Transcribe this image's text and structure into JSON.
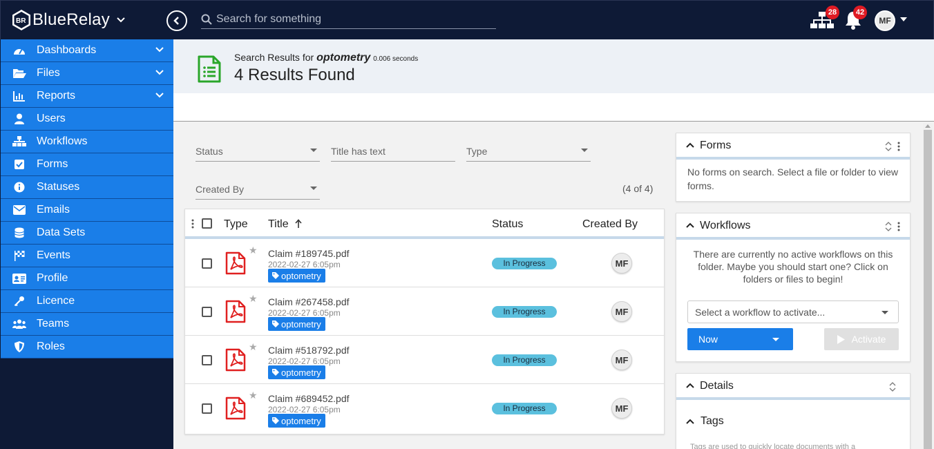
{
  "app": {
    "name": "BlueRelay",
    "logo_letters": "BR"
  },
  "search": {
    "placeholder": "Search for something"
  },
  "notifications": {
    "workflow_count": "28",
    "bell_count": "42"
  },
  "user": {
    "initials": "MF"
  },
  "sidebar": {
    "items": [
      {
        "label": "Dashboards",
        "icon": "dashboard-icon",
        "expandable": true
      },
      {
        "label": "Files",
        "icon": "folder-open-icon",
        "expandable": true
      },
      {
        "label": "Reports",
        "icon": "chart-icon",
        "expandable": true
      },
      {
        "label": "Users",
        "icon": "user-icon",
        "expandable": false
      },
      {
        "label": "Workflows",
        "icon": "sitemap-icon",
        "expandable": false
      },
      {
        "label": "Forms",
        "icon": "check-square-icon",
        "expandable": false
      },
      {
        "label": "Statuses",
        "icon": "info-circle-icon",
        "expandable": false
      },
      {
        "label": "Emails",
        "icon": "envelope-icon",
        "expandable": false
      },
      {
        "label": "Data Sets",
        "icon": "database-icon",
        "expandable": false
      },
      {
        "label": "Events",
        "icon": "flag-checkered-icon",
        "expandable": false
      },
      {
        "label": "Profile",
        "icon": "id-card-icon",
        "expandable": false
      },
      {
        "label": "Licence",
        "icon": "key-icon",
        "expandable": false
      },
      {
        "label": "Teams",
        "icon": "users-icon",
        "expandable": false
      },
      {
        "label": "Roles",
        "icon": "shield-icon",
        "expandable": false
      }
    ]
  },
  "results": {
    "prefix": "Search Results for",
    "query": "optometry",
    "seconds": "0.006 seconds",
    "count_text": "4 Results Found",
    "paging": "(4 of 4)"
  },
  "filters": {
    "status_placeholder": "Status",
    "title_placeholder": "Title has text",
    "type_placeholder": "Type",
    "created_by_placeholder": "Created By"
  },
  "table": {
    "columns": {
      "type": "Type",
      "title": "Title",
      "status": "Status",
      "created_by": "Created By"
    },
    "rows": [
      {
        "title": "Claim #189745.pdf",
        "date": "2022-02-27 6:05pm",
        "tag": "optometry",
        "status": "In Progress",
        "creator": "MF"
      },
      {
        "title": "Claim #267458.pdf",
        "date": "2022-02-27 6:05pm",
        "tag": "optometry",
        "status": "In Progress",
        "creator": "MF"
      },
      {
        "title": "Claim #518792.pdf",
        "date": "2022-02-27 6:05pm",
        "tag": "optometry",
        "status": "In Progress",
        "creator": "MF"
      },
      {
        "title": "Claim #689452.pdf",
        "date": "2022-02-27 6:05pm",
        "tag": "optometry",
        "status": "In Progress",
        "creator": "MF"
      }
    ]
  },
  "panels": {
    "forms": {
      "title": "Forms",
      "body": "No forms on search. Select a file or folder to view forms."
    },
    "workflows": {
      "title": "Workflows",
      "body": "There are currently no active workflows on this folder. Maybe you should start one? Click on folders or files to begin!",
      "select_placeholder": "Select a workflow to activate...",
      "now_label": "Now",
      "activate_label": "Activate"
    },
    "details": {
      "title": "Details"
    },
    "tags": {
      "title": "Tags",
      "body": "Tags are used to quickly locate documents with a"
    }
  },
  "colors": {
    "brand_blue": "#1a7ee8",
    "navy": "#0e1a36",
    "status_info": "#5bc0de",
    "badge_red": "#e01b24",
    "pdf_red": "#e02020"
  }
}
